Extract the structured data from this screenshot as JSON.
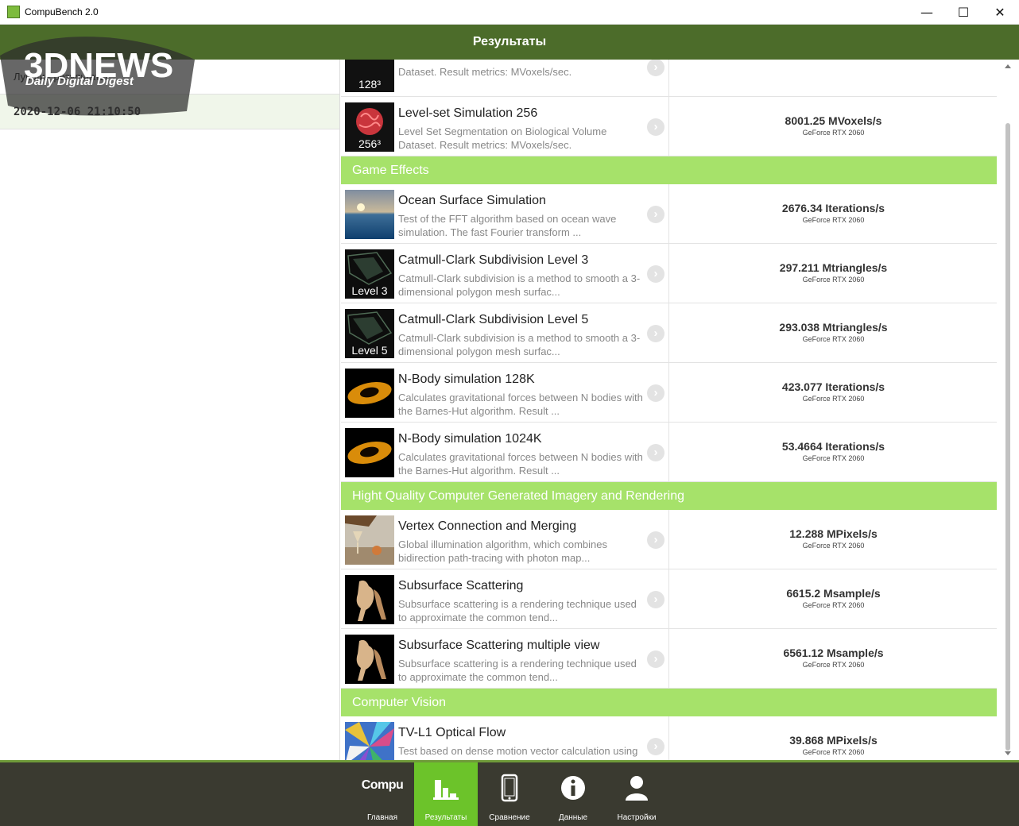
{
  "window": {
    "title": "CompuBench 2.0",
    "minimize": "—",
    "maximize": "☐",
    "close": "✕"
  },
  "header": {
    "title": "Результаты"
  },
  "left": {
    "heading": "Лучшие результаты",
    "entry": "2020-12-06 21:10:50"
  },
  "watermark": {
    "brand": "3DNEWS",
    "tagline": "Daily Digital Digest"
  },
  "rows": [
    {
      "thumb_label": "128³",
      "title": "",
      "desc": "Dataset. Result metrics: MVoxels/sec.",
      "score": "",
      "device": ""
    },
    {
      "thumb_label": "256³",
      "title": "Level-set Simulation 256",
      "desc": "Level Set Segmentation on Biological Volume Dataset. Result metrics: MVoxels/sec.",
      "score": "8001.25 MVoxels/s",
      "device": "GeForce RTX 2060"
    }
  ],
  "sections": [
    {
      "name": "Game Effects",
      "rows": [
        {
          "thumb_label": "",
          "title": "Ocean Surface Simulation",
          "desc": "Test of the FFT algorithm based on ocean wave simulation. The fast Fourier transform ...",
          "score": "2676.34 Iterations/s",
          "device": "GeForce RTX 2060"
        },
        {
          "thumb_label": "Level 3",
          "title": "Catmull-Clark Subdivision Level 3",
          "desc": "Catmull-Clark subdivision is a method to smooth a 3-dimensional polygon mesh surfac...",
          "score": "297.211 Mtriangles/s",
          "device": "GeForce RTX 2060"
        },
        {
          "thumb_label": "Level 5",
          "title": "Catmull-Clark Subdivision Level 5",
          "desc": "Catmull-Clark subdivision is a method to smooth a 3-dimensional polygon mesh surfac...",
          "score": "293.038 Mtriangles/s",
          "device": "GeForce RTX 2060"
        },
        {
          "thumb_label": "",
          "title": "N-Body simulation 128K",
          "desc": "Calculates gravitational forces between N bodies with the Barnes-Hut algorithm. Result ...",
          "score": "423.077 Iterations/s",
          "device": "GeForce RTX 2060"
        },
        {
          "thumb_label": "",
          "title": "N-Body simulation 1024K",
          "desc": "Calculates gravitational forces between N bodies with the Barnes-Hut algorithm. Result ...",
          "score": "53.4664 Iterations/s",
          "device": "GeForce RTX 2060"
        }
      ]
    },
    {
      "name": "Hight Quality Computer Generated Imagery and Rendering",
      "rows": [
        {
          "thumb_label": "",
          "title": "Vertex Connection and Merging",
          "desc": "Global illumination algorithm, which combines bidirection path-tracing with photon map...",
          "score": "12.288 MPixels/s",
          "device": "GeForce RTX 2060"
        },
        {
          "thumb_label": "",
          "title": "Subsurface Scattering",
          "desc": "Subsurface scattering is a rendering technique used to approximate the common tend...",
          "score": "6615.2 Msample/s",
          "device": "GeForce RTX 2060"
        },
        {
          "thumb_label": "",
          "title": "Subsurface Scattering multiple view",
          "desc": "Subsurface scattering is a rendering technique used to approximate the common tend...",
          "score": "6561.12 Msample/s",
          "device": "GeForce RTX 2060"
        }
      ]
    },
    {
      "name": "Computer Vision",
      "rows": [
        {
          "thumb_label": "",
          "title": "TV-L1 Optical Flow",
          "desc": "Test based on dense motion vector calculation using variational method. Optical flow is...",
          "score": "39.868 MPixels/s",
          "device": "GeForce RTX 2060"
        }
      ]
    }
  ],
  "nav": {
    "logo": "Compu",
    "items": [
      {
        "label": "Главная",
        "icon": "compu-logo"
      },
      {
        "label": "Результаты",
        "icon": "bar-chart-icon",
        "active": true
      },
      {
        "label": "Сравнение",
        "icon": "phone-icon"
      },
      {
        "label": "Данные",
        "icon": "info-icon"
      },
      {
        "label": "Настройки",
        "icon": "user-icon"
      }
    ]
  },
  "colors": {
    "header": "#4c6c2a",
    "section": "#a6e26a",
    "nav_active": "#6cc32a",
    "navbar": "#3a3a30"
  }
}
